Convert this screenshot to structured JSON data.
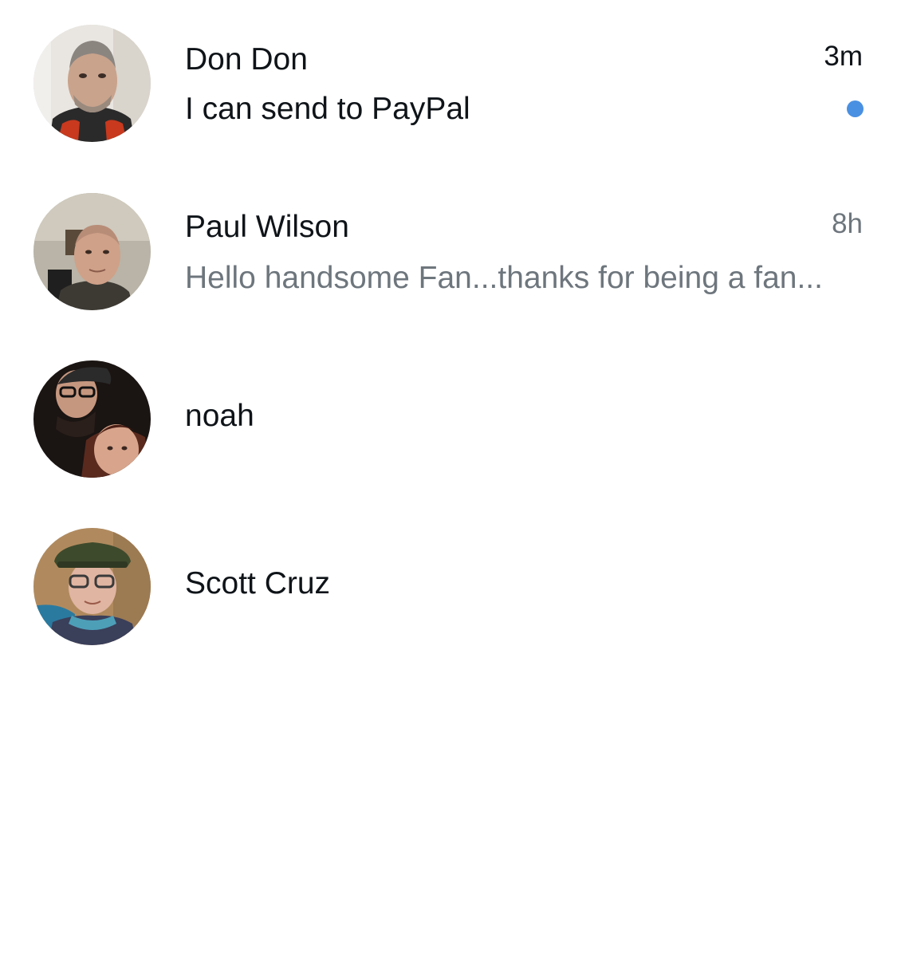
{
  "conversations": [
    {
      "name": "Don Don",
      "preview": "I can send to PayPal",
      "time": "3m",
      "unread": true,
      "avatar_icon": "user-photo-avatar"
    },
    {
      "name": "Paul Wilson",
      "preview": "Hello handsome Fan...thanks for being a fan...",
      "time": "8h",
      "unread": false,
      "avatar_icon": "user-photo-avatar"
    },
    {
      "name": "noah",
      "preview": "",
      "time": "",
      "unread": false,
      "avatar_icon": "user-photo-avatar"
    },
    {
      "name": "Scott Cruz",
      "preview": "",
      "time": "",
      "unread": false,
      "avatar_icon": "user-photo-avatar"
    }
  ],
  "colors": {
    "text_primary": "#0f1419",
    "text_secondary": "#6e767d",
    "unread_dot": "#4a90e2",
    "background": "#ffffff"
  }
}
